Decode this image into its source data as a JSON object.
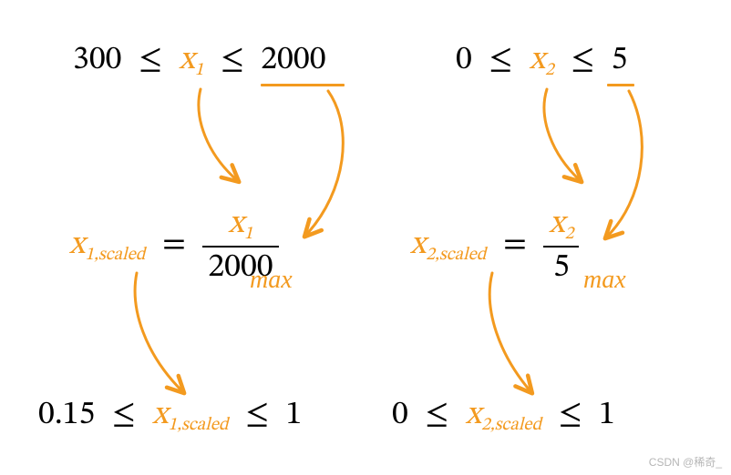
{
  "left": {
    "range_low": "300",
    "range_var": "x",
    "range_sub": "1",
    "range_high": "2000",
    "scaled_var": "x",
    "scaled_sub": "1,scaled",
    "frac_num_var": "x",
    "frac_num_sub": "1",
    "frac_den": "2000",
    "result_low": "0.15",
    "result_var": "x",
    "result_sub": "1,scaled",
    "result_high": "1",
    "max_label": "max"
  },
  "right": {
    "range_low": "0",
    "range_var": "x",
    "range_sub": "2",
    "range_high": "5",
    "scaled_var": "x",
    "scaled_sub": "2,scaled",
    "frac_num_var": "x",
    "frac_num_sub": "2",
    "frac_den": "5",
    "result_low": "0",
    "result_var": "x",
    "result_sub": "2,scaled",
    "result_high": "1",
    "max_label": "max"
  },
  "ops": {
    "le": "≤",
    "eq": "="
  },
  "watermark": "CSDN @稀奇_",
  "colors": {
    "accent": "#f39a1f"
  }
}
